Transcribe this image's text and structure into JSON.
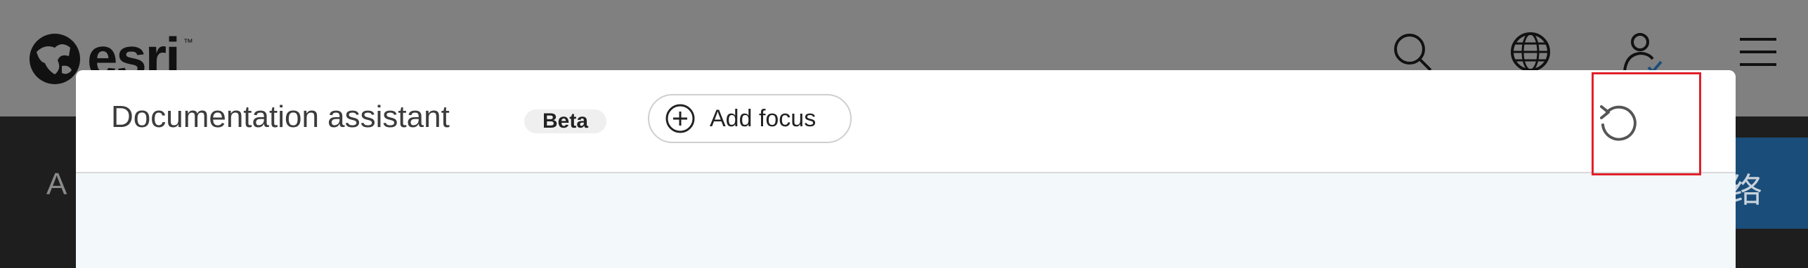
{
  "header": {
    "logo_text": "esri",
    "logo_tm": "™",
    "icons": [
      "search-icon",
      "globe-icon",
      "user-icon",
      "menu-icon"
    ]
  },
  "subnav": {
    "left_text": "A",
    "right_button_text": "络"
  },
  "modal": {
    "title": "Documentation assistant",
    "badge": "Beta",
    "add_focus_label": "Add focus",
    "reset_icon": "reset-icon"
  },
  "colors": {
    "highlight": "#e0202a",
    "body_bg": "#f3f8fa",
    "subnav_button": "#1a4d7a"
  }
}
